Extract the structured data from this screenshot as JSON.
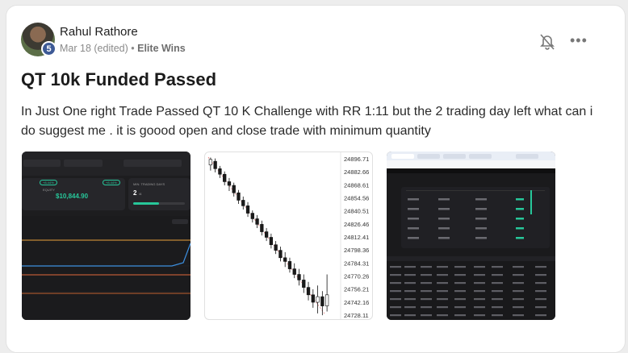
{
  "post": {
    "author": "Rahul Rathore",
    "avatar_badge": "5",
    "date": "Mar 18 (edited)",
    "separator": "•",
    "community": "Elite Wins",
    "title": "QT 10k Funded Passed",
    "body": "In Just One right Trade Passed QT 10 K Challenge with RR 1:11 but the 2 trading day left what can i do suggest me . it is goood open and close trade with minimum quantity",
    "more_label": "•••"
  },
  "thumb1": {
    "equity_label": "EQUITY",
    "equity_value": "$10,844.90",
    "days_label": "MIN. TRADING DAYS",
    "days_value": "2",
    "days_total": "/4",
    "pill1": "+8.44%",
    "pill2": "+8.44%"
  },
  "thumb2": {
    "price_ticks": [
      "24896.71",
      "24882.66",
      "24868.61",
      "24854.56",
      "24840.51",
      "24826.46",
      "24812.41",
      "24798.36",
      "24784.31",
      "24770.26",
      "24756.21",
      "24742.16",
      "24728.11"
    ],
    "candles": [
      {
        "o": 24890,
        "c": 24896,
        "h": 24898,
        "l": 24884
      },
      {
        "o": 24894,
        "c": 24886,
        "h": 24897,
        "l": 24882
      },
      {
        "o": 24886,
        "c": 24880,
        "h": 24889,
        "l": 24876
      },
      {
        "o": 24880,
        "c": 24872,
        "h": 24883,
        "l": 24868
      },
      {
        "o": 24872,
        "c": 24868,
        "h": 24876,
        "l": 24862
      },
      {
        "o": 24868,
        "c": 24860,
        "h": 24871,
        "l": 24856
      },
      {
        "o": 24860,
        "c": 24852,
        "h": 24863,
        "l": 24848
      },
      {
        "o": 24852,
        "c": 24846,
        "h": 24856,
        "l": 24842
      },
      {
        "o": 24846,
        "c": 24838,
        "h": 24850,
        "l": 24834
      },
      {
        "o": 24838,
        "c": 24832,
        "h": 24841,
        "l": 24828
      },
      {
        "o": 24832,
        "c": 24826,
        "h": 24836,
        "l": 24822
      },
      {
        "o": 24826,
        "c": 24818,
        "h": 24830,
        "l": 24814
      },
      {
        "o": 24818,
        "c": 24812,
        "h": 24822,
        "l": 24808
      },
      {
        "o": 24812,
        "c": 24804,
        "h": 24816,
        "l": 24800
      },
      {
        "o": 24804,
        "c": 24798,
        "h": 24808,
        "l": 24794
      },
      {
        "o": 24798,
        "c": 24790,
        "h": 24802,
        "l": 24786
      },
      {
        "o": 24790,
        "c": 24786,
        "h": 24796,
        "l": 24780
      },
      {
        "o": 24786,
        "c": 24778,
        "h": 24790,
        "l": 24774
      },
      {
        "o": 24778,
        "c": 24772,
        "h": 24784,
        "l": 24768
      },
      {
        "o": 24772,
        "c": 24766,
        "h": 24778,
        "l": 24760
      },
      {
        "o": 24766,
        "c": 24758,
        "h": 24772,
        "l": 24752
      },
      {
        "o": 24758,
        "c": 24750,
        "h": 24764,
        "l": 24744
      },
      {
        "o": 24750,
        "c": 24742,
        "h": 24756,
        "l": 24736
      },
      {
        "o": 24742,
        "c": 24748,
        "h": 24760,
        "l": 24730
      },
      {
        "o": 24748,
        "c": 24738,
        "h": 24754,
        "l": 24728
      },
      {
        "o": 24738,
        "c": 24750,
        "h": 24772,
        "l": 24732
      }
    ]
  },
  "colors": {
    "accent_green": "#27c79a",
    "bear": "#1a1a1a",
    "bull": "#ffffff",
    "orange": "#e8a23a",
    "blue": "#3c8fe0"
  }
}
